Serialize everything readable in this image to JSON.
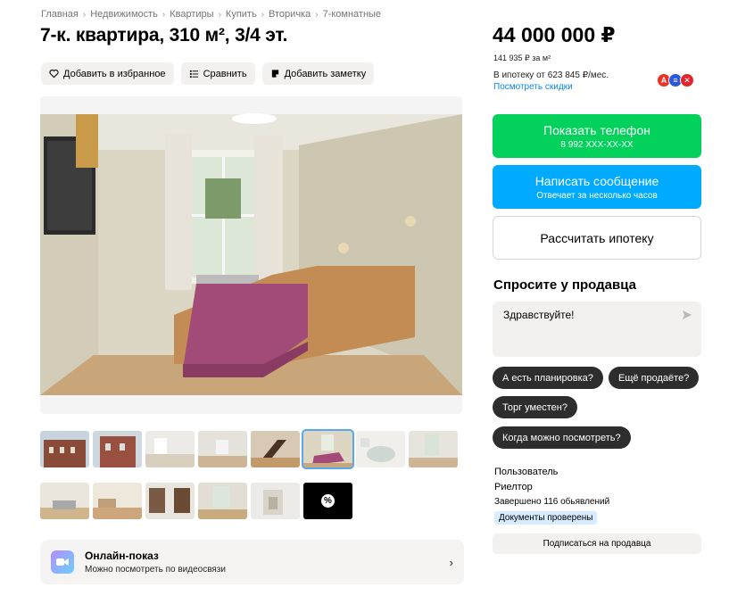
{
  "breadcrumb": [
    "Главная",
    "Недвижимость",
    "Квартиры",
    "Купить",
    "Вторичка",
    "7-комнатные"
  ],
  "title": "7-к. квартира, 310 м², 3/4 эт.",
  "actions": {
    "favorite": "Добавить в избранное",
    "compare": "Сравнить",
    "note": "Добавить заметку"
  },
  "gallery": {
    "thumbs_row1_count": 8,
    "thumbs_row2_count": 5,
    "active_thumb": 6,
    "more_icon": "percent-icon"
  },
  "online_show": {
    "title": "Онлайн-показ",
    "subtitle": "Можно посмотреть по видеосвязи"
  },
  "price": {
    "total": "44 000 000 ₽",
    "per_m2": "141 935 ₽ за м²",
    "mortgage": "В ипотеку от 623 845 ₽/мес.",
    "discounts": "Посмотреть скидки"
  },
  "buttons": {
    "phone": "Показать телефон",
    "phone_number": "8 992 XXX-XX-XX",
    "message": "Написать сообщение",
    "message_sub": "Отвечает за несколько часов",
    "mortgage_calc": "Рассчитать ипотеку"
  },
  "ask": {
    "title": "Спросите у продавца",
    "input_value": "Здравствуйте!",
    "chips": [
      "А есть планировка?",
      "Ещё продаёте?",
      "Торг уместен?",
      "Когда можно посмотреть?"
    ]
  },
  "seller": {
    "name": "Пользователь",
    "type": "Риелтор",
    "completed": "Завершено 116 обьявлений",
    "verified": "Документы проверены",
    "subscribe": "Подписаться на продавца"
  },
  "colors": {
    "green": "#02d15c",
    "blue": "#00aaff",
    "link": "#0a88e0",
    "chip": "#2d2d2d"
  }
}
